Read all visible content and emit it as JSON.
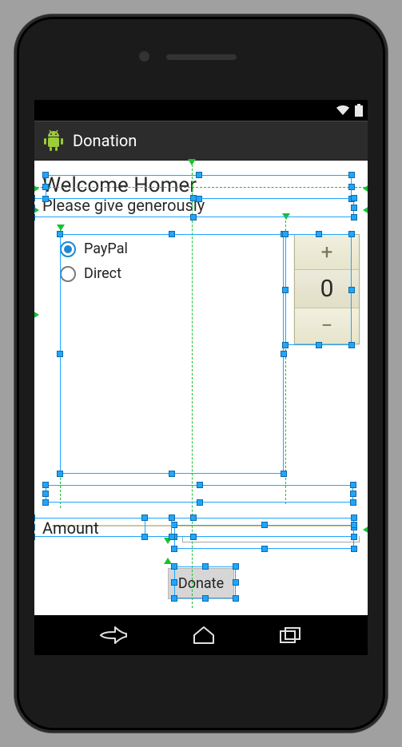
{
  "status": {
    "wifi": true,
    "battery": true
  },
  "actionbar": {
    "title": "Donation"
  },
  "content": {
    "welcome": "Welcome Homer",
    "subtitle": "Please give generously",
    "payment_options": [
      {
        "label": "PayPal",
        "selected": true
      },
      {
        "label": "Direct",
        "selected": false
      }
    ],
    "stepper": {
      "value": "0",
      "plus": "+",
      "minus": "−"
    },
    "amount_label": "Amount",
    "amount_value": "",
    "donate_label": "Donate"
  },
  "colors": {
    "accent": "#1e88d0",
    "guide": "#16c22f",
    "select": "#1fa6ff"
  }
}
